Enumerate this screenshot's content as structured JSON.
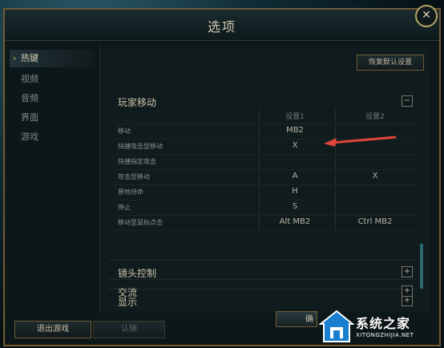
{
  "window": {
    "title": "选项",
    "close": "✕"
  },
  "sidebar": {
    "items": [
      {
        "label": "热键",
        "active": true
      },
      {
        "label": "视频",
        "active": false
      },
      {
        "label": "音频",
        "active": false
      },
      {
        "label": "界面",
        "active": false
      },
      {
        "label": "游戏",
        "active": false
      }
    ]
  },
  "toolbar": {
    "reset_label": "恢复默认设置"
  },
  "player_movement": {
    "title": "玩家移动",
    "toggle": "−",
    "headers": {
      "col1": "设置1",
      "col2": "设置2"
    },
    "rows": [
      {
        "action": "移动",
        "key1": "MB2",
        "key2": ""
      },
      {
        "action": "快捷攻击型移动",
        "key1": "X",
        "key2": ""
      },
      {
        "action": "快捷指定攻击",
        "key1": "",
        "key2": ""
      },
      {
        "action": "攻击型移动",
        "key1": "A",
        "key2": "X"
      },
      {
        "action": "原地待命",
        "key1": "H",
        "key2": ""
      },
      {
        "action": "停止",
        "key1": "S",
        "key2": ""
      },
      {
        "action": "移动至鼠标点击",
        "key1": "Alt MB2",
        "key2": "Ctrl MB2"
      }
    ]
  },
  "sections": [
    {
      "title": "镜头控制",
      "toggle": "+"
    },
    {
      "title": "显示",
      "toggle": "+"
    },
    {
      "title": "交流",
      "toggle": "+"
    }
  ],
  "footer": {
    "quit_label": "退出游戏",
    "confirm_label": "认输",
    "ok_label": "确"
  },
  "watermark": {
    "text": "系统之家",
    "url": "XITONGZHIJIA.NET"
  },
  "colors": {
    "accent": "#6f5b33",
    "highlight_arrow": "#e0453a"
  }
}
